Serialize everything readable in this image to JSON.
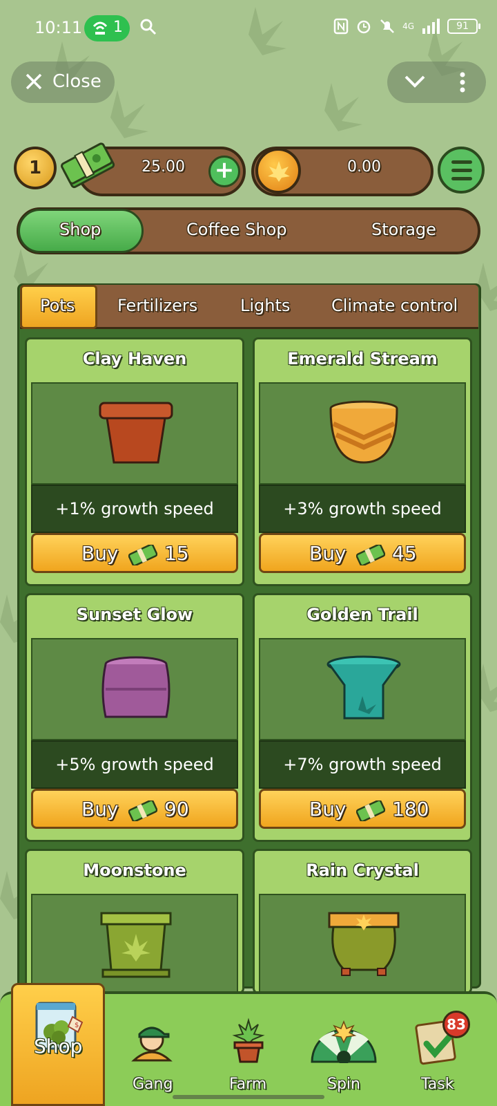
{
  "status_bar": {
    "time": "10:11",
    "hotspot_count": "1",
    "network": "4G",
    "battery": "91"
  },
  "top_bar": {
    "close_label": "Close"
  },
  "currency": {
    "level": "1",
    "cash": "25.00",
    "coins": "0.00"
  },
  "main_tabs": [
    {
      "label": "Shop",
      "active": true
    },
    {
      "label": "Coffee Shop",
      "active": false
    },
    {
      "label": "Storage",
      "active": false
    }
  ],
  "categories": [
    {
      "label": "Pots",
      "active": true
    },
    {
      "label": "Fertilizers",
      "active": false
    },
    {
      "label": "Lights",
      "active": false
    },
    {
      "label": "Climate control",
      "active": false
    }
  ],
  "buy_label": "Buy",
  "items": [
    {
      "name": "Clay Haven",
      "bonus": "+1% growth speed",
      "price": "15",
      "pot_color": "#c2542a",
      "icon": "clay-pot-icon"
    },
    {
      "name": "Emerald Stream",
      "bonus": "+3% growth speed",
      "price": "45",
      "pot_color": "#f0a93a",
      "icon": "chevron-pot-icon"
    },
    {
      "name": "Sunset Glow",
      "bonus": "+5% growth speed",
      "price": "90",
      "pot_color": "#a05a9a",
      "icon": "barrel-pot-icon"
    },
    {
      "name": "Golden Trail",
      "bonus": "+7% growth speed",
      "price": "180",
      "pot_color": "#2aa79a",
      "icon": "teal-pot-icon"
    },
    {
      "name": "Moonstone",
      "pot_color": "#8aa632",
      "icon": "square-pot-icon"
    },
    {
      "name": "Rain Crystal",
      "pot_color": "#8a9a2a",
      "icon": "cauldron-pot-icon"
    }
  ],
  "bottom_nav": [
    {
      "label": "Shop",
      "icon": "weed-bag-icon",
      "active": true
    },
    {
      "label": "Gang",
      "icon": "gang-avatar-icon",
      "active": false
    },
    {
      "label": "Farm",
      "icon": "plant-pot-icon",
      "active": false
    },
    {
      "label": "Spin",
      "icon": "wheel-icon",
      "active": false
    },
    {
      "label": "Task",
      "icon": "task-check-icon",
      "active": false,
      "badge": "83"
    }
  ],
  "colors": {
    "background": "#a8c58f",
    "wood": "#8a5d3b",
    "gold": "#f0a51e",
    "green": "#4fbf5c",
    "panel": "#3e6f2d"
  }
}
